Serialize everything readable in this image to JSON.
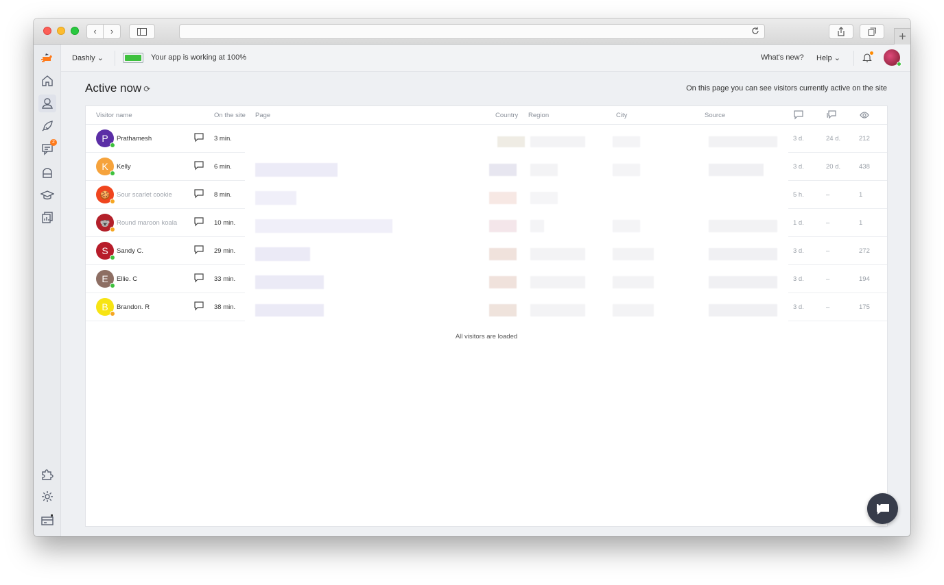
{
  "browser": {
    "url": ""
  },
  "appbar": {
    "project": "Dashly",
    "status": "Your app is working at 100%",
    "whats_new": "What's new?",
    "help": "Help"
  },
  "sidebar": {
    "items": [
      {
        "name": "home-icon"
      },
      {
        "name": "visitors-icon",
        "active": true
      },
      {
        "name": "rocket-icon"
      },
      {
        "name": "chats-icon",
        "badge": "2"
      },
      {
        "name": "knowledge-icon"
      },
      {
        "name": "academy-icon"
      },
      {
        "name": "reports-icon"
      },
      {
        "name": "puzzle-icon"
      },
      {
        "name": "gear-icon"
      },
      {
        "name": "billing-icon"
      }
    ]
  },
  "page": {
    "title": "Active now",
    "hint": "On this page you can see visitors currently active on the site",
    "loaded_text": "All visitors are loaded"
  },
  "table": {
    "columns": {
      "visitor": "Visitor name",
      "onsite": "On the site",
      "page": "Page",
      "country": "Country",
      "region": "Region",
      "city": "City",
      "source": "Source"
    },
    "rows": [
      {
        "initial": "P",
        "name": "Prathamesh",
        "guest": false,
        "color": "#5b2ea6",
        "status": "#3ec13e",
        "onsite": "3 min.",
        "last": "3 d.",
        "conv": "24 d.",
        "views": "212"
      },
      {
        "initial": "K",
        "name": "Kelly",
        "guest": false,
        "color": "#f6a33c",
        "status": "#3ec13e",
        "onsite": "6 min.",
        "last": "3 d.",
        "conv": "20 d.",
        "views": "438"
      },
      {
        "initial": "",
        "name": "Sour scarlet cookie",
        "guest": true,
        "color": "#f0451e",
        "status": "#f5a623",
        "onsite": "8 min.",
        "last": "5 h.",
        "conv": "–",
        "views": "1"
      },
      {
        "initial": "",
        "name": "Round maroon koala",
        "guest": true,
        "color": "#b3202a",
        "status": "#f5a623",
        "onsite": "10 min.",
        "last": "1 d.",
        "conv": "–",
        "views": "1"
      },
      {
        "initial": "S",
        "name": "Sandy C.",
        "guest": false,
        "color": "#b71c2a",
        "status": "#3ec13e",
        "onsite": "29 min.",
        "last": "3 d.",
        "conv": "–",
        "views": "272"
      },
      {
        "initial": "E",
        "name": "Ellie. C",
        "guest": false,
        "color": "#8d6e63",
        "status": "#3ec13e",
        "onsite": "33 min.",
        "last": "3 d.",
        "conv": "–",
        "views": "194"
      },
      {
        "initial": "B",
        "name": "Brandon. R",
        "guest": false,
        "color": "#f7e414",
        "status": "#f5a623",
        "onsite": "38 min.",
        "last": "3 d.",
        "conv": "–",
        "views": "175"
      }
    ]
  }
}
